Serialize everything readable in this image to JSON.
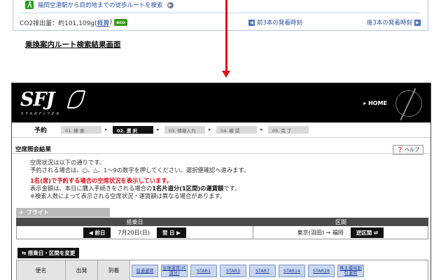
{
  "transit": {
    "walk_text": "福岡空港駅から目的地までの徒歩ルートを検索",
    "co2_label": "CO2排出量：約101,109g(",
    "co2_link": "概算",
    "co2_close": ")",
    "eco_badge": "eco",
    "prev_link": "前3本の発着時刻",
    "next_link": "後3本の発着時刻"
  },
  "caption": "乗換案内ルート検索結果画面",
  "sfj": {
    "logo": "SFJ",
    "logo_sub": "STARFLYER",
    "home": "▸ HOME",
    "steps_title": "予約",
    "steps": [
      {
        "label": "01. 検 索"
      },
      {
        "label": "02. 選 択"
      },
      {
        "label": "03. 情報入力"
      },
      {
        "label": "04. 確 認"
      },
      {
        "label": "05. 完 了"
      }
    ],
    "section_title": "空席照会結果",
    "help": "❓ ヘルプ",
    "info_lines": [
      "空席状況は以下の通りです。",
      "予約される場合は、○、△、1～9の数字を押してください。選択便確認へ進みます。"
    ],
    "info_red": "1名(席)で予約する場合の空席状況を表示しています。",
    "info_line3_a": "表示金額は、本日に購入手続きをされる場合の",
    "info_line3_b": "1名片道分(1区間)の運賃額",
    "info_line3_c": "です。",
    "info_line4": "※検索人数によって表示される空席状況・運賃額は異なる場合があります。",
    "flight_label": "フライト",
    "date_header": "搭乗日",
    "route_header": "区間",
    "prev_day": "◀ 前日",
    "date": "7月20日(日)",
    "next_day": "翌 日 ▶",
    "route": "東京(羽田) → 福岡",
    "reverse": "逆区間 ⇄",
    "change_btn": "⇆ 搭乗日・区間を変更",
    "cols": {
      "flight": "便名",
      "dep": "出発",
      "arr": "到着"
    },
    "fares": [
      "普通運賃",
      "往復運賃(片道分)",
      "STAR1",
      "STAR3",
      "STAR7",
      "STAR14",
      "STAR28",
      "株主優待割引運賃"
    ]
  }
}
